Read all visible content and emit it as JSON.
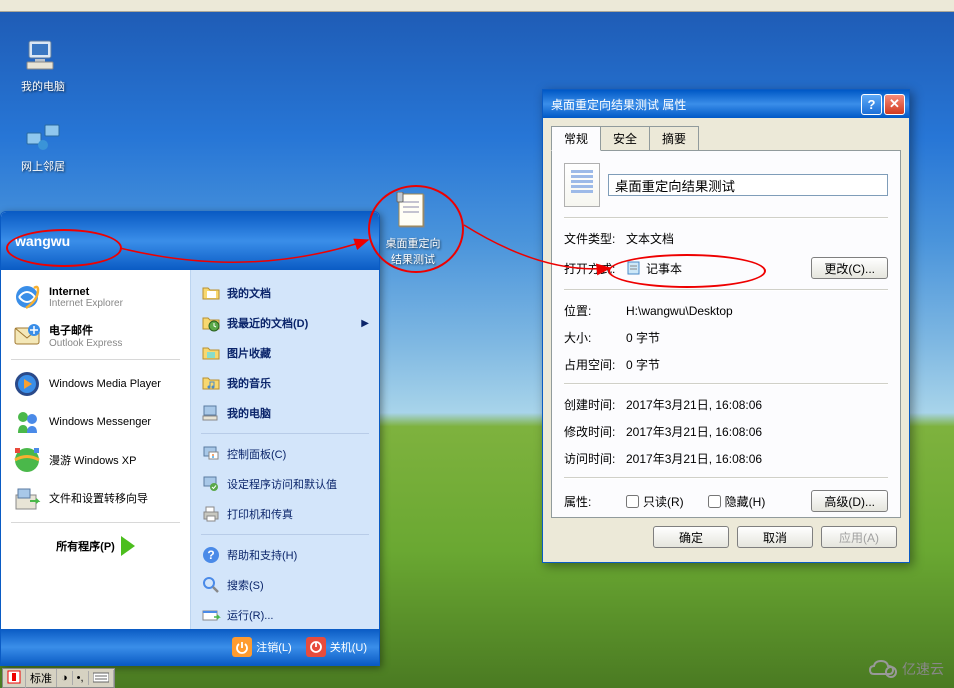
{
  "desktop": {
    "icons": {
      "my_computer": "我的电脑",
      "network_neighbor": "网上邻居",
      "test_file": "桌面重定向\n结果测试"
    }
  },
  "start_menu": {
    "username": "wangwu",
    "left": {
      "internet": {
        "title": "Internet",
        "sub": "Internet Explorer"
      },
      "email": {
        "title": "电子邮件",
        "sub": "Outlook Express"
      },
      "wmp": "Windows Media Player",
      "messenger": "Windows Messenger",
      "tour": "漫游 Windows XP",
      "transfer": "文件和设置转移向导",
      "all_programs": "所有程序(P)"
    },
    "right": {
      "my_docs": "我的文档",
      "recent_docs": "我最近的文档(D)",
      "pictures": "图片收藏",
      "music": "我的音乐",
      "my_computer": "我的电脑",
      "control_panel": "控制面板(C)",
      "program_access": "设定程序访问和默认值",
      "printers": "打印机和传真",
      "help": "帮助和支持(H)",
      "search": "搜索(S)",
      "run": "运行(R)..."
    },
    "footer": {
      "logoff": "注销(L)",
      "shutdown": "关机(U)"
    }
  },
  "properties": {
    "window_title": "桌面重定向结果测试  属性",
    "tabs": {
      "general": "常规",
      "security": "安全",
      "summary": "摘要"
    },
    "filename": "桌面重定向结果测试",
    "rows": {
      "file_type": {
        "label": "文件类型:",
        "value": "文本文档"
      },
      "open_with": {
        "label": "打开方式:",
        "value": "记事本",
        "button": "更改(C)..."
      },
      "location": {
        "label": "位置:",
        "value": "H:\\wangwu\\Desktop"
      },
      "size": {
        "label": "大小:",
        "value": "0 字节"
      },
      "size_disk": {
        "label": "占用空间:",
        "value": "0 字节"
      },
      "created": {
        "label": "创建时间:",
        "value": "2017年3月21日, 16:08:06"
      },
      "modified": {
        "label": "修改时间:",
        "value": "2017年3月21日, 16:08:06"
      },
      "accessed": {
        "label": "访问时间:",
        "value": "2017年3月21日, 16:08:06"
      },
      "attributes": {
        "label": "属性:",
        "readonly": "只读(R)",
        "hidden": "隐藏(H)",
        "advanced": "高级(D)..."
      }
    },
    "footer": {
      "ok": "确定",
      "cancel": "取消",
      "apply": "应用(A)"
    }
  },
  "tray": {
    "mode": "标准"
  },
  "watermark": "亿速云"
}
